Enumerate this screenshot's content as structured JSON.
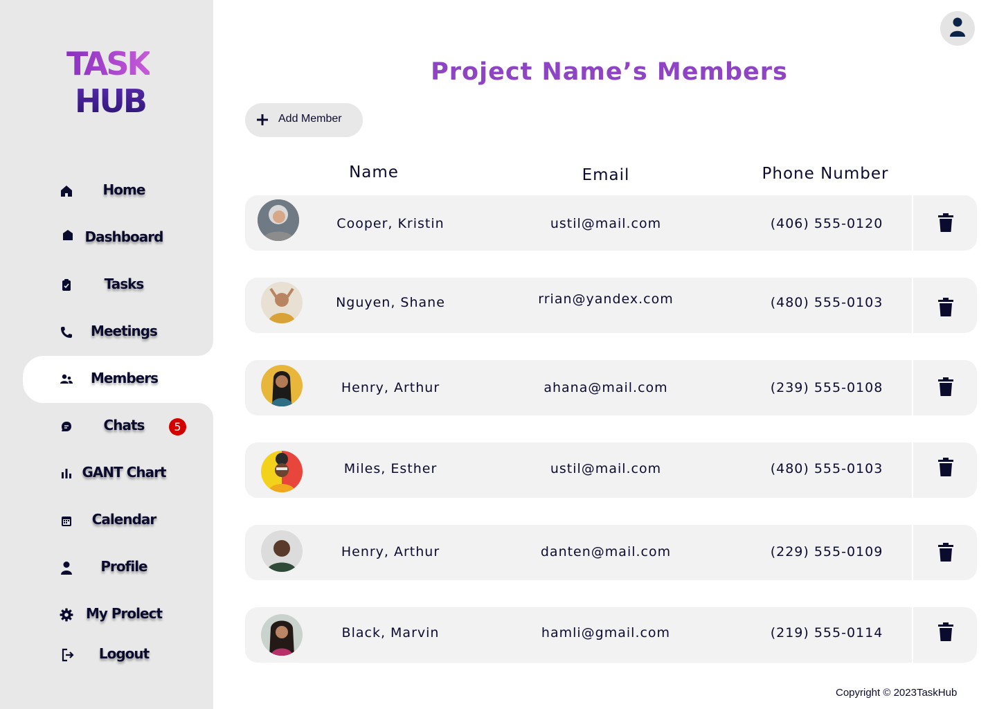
{
  "brand": {
    "line1": "TASK",
    "line2": "HUB"
  },
  "sidebar": {
    "items": [
      {
        "label": "Home",
        "icon": "home-icon"
      },
      {
        "label": "Dashboard",
        "icon": "dashboard-icon"
      },
      {
        "label": "Tasks",
        "icon": "clipboard-check-icon"
      },
      {
        "label": "Meetings",
        "icon": "phone-icon"
      },
      {
        "label": "Members",
        "icon": "users-icon",
        "active": true
      },
      {
        "label": "Chats",
        "icon": "chat-icon",
        "badge": "5"
      },
      {
        "label": "GANT Chart",
        "icon": "bar-chart-icon"
      },
      {
        "label": "Calendar",
        "icon": "calendar-icon"
      },
      {
        "label": "Profile",
        "icon": "user-icon"
      },
      {
        "label": "My Prolect",
        "icon": "gear-icon"
      },
      {
        "label": "Logout",
        "icon": "logout-icon"
      }
    ]
  },
  "header": {
    "title": "Project Name’s Members",
    "user_icon": "user-avatar-icon"
  },
  "toolbar": {
    "add_label": "Add Member"
  },
  "table": {
    "columns": [
      "Name",
      "Email",
      "Phone Number"
    ],
    "rows": [
      {
        "name": "Cooper, Kristin",
        "email": "ustil@mail.com",
        "phone": "(406) 555-0120"
      },
      {
        "name": "Nguyen, Shane",
        "email": "rrian@yandex.com",
        "phone": "(480) 555-0103"
      },
      {
        "name": "Henry, Arthur",
        "email": "ahana@mail.com",
        "phone": "(239) 555-0108"
      },
      {
        "name": "Miles, Esther",
        "email": "ustil@mail.com",
        "phone": "(480) 555-0103"
      },
      {
        "name": "Henry, Arthur",
        "email": "danten@mail.com",
        "phone": "(229) 555-0109"
      },
      {
        "name": "Black, Marvin",
        "email": "hamli@gmail.com",
        "phone": "(219) 555-0114"
      }
    ]
  },
  "footer": {
    "copyright": "Copyright © 2023TaskHub"
  },
  "colors": {
    "accent": "#8e44c4",
    "text": "#0b0b2e",
    "badge": "#d40000",
    "sidebar": "#e8e8e8",
    "row": "#f2f2f2"
  }
}
